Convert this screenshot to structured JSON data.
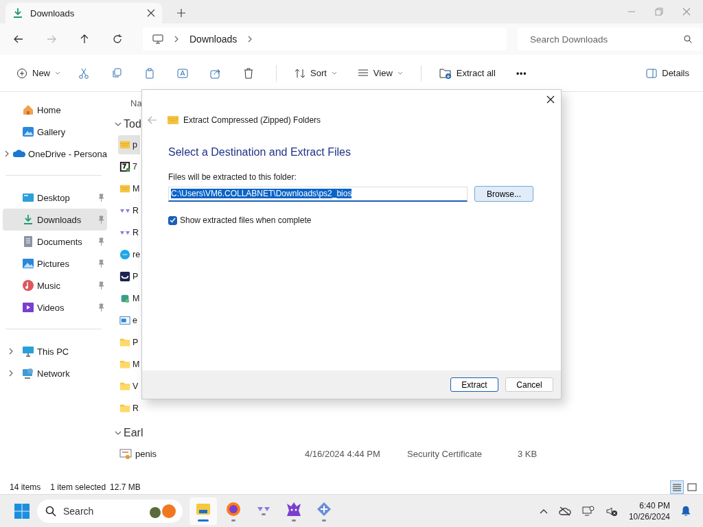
{
  "tab": {
    "title": "Downloads"
  },
  "address": {
    "breadcrumb": [
      "Downloads"
    ],
    "search_placeholder": "Search Downloads"
  },
  "command_bar": [
    {
      "kind": "menu",
      "label": "New"
    },
    {
      "kind": "icon"
    },
    {
      "kind": "icon"
    },
    {
      "kind": "icon"
    },
    {
      "kind": "icon"
    },
    {
      "kind": "icon"
    },
    {
      "kind": "icon"
    },
    {
      "kind": "menu",
      "label": "Sort"
    },
    {
      "kind": "menu",
      "label": "View"
    },
    {
      "kind": "button",
      "label": "Extract all"
    },
    {
      "kind": "more",
      "label": "•••"
    },
    {
      "kind": "details",
      "label": "Details"
    }
  ],
  "nav": [
    [
      {
        "label": "Home",
        "selected": false,
        "expandable": false,
        "pinned": false
      },
      {
        "label": "Gallery",
        "selected": false,
        "expandable": false,
        "pinned": false
      },
      {
        "label": "OneDrive - Persona",
        "selected": false,
        "expandable": true,
        "pinned": false
      }
    ],
    [
      {
        "label": "Desktop",
        "selected": false,
        "expandable": false,
        "pinned": true
      },
      {
        "label": "Downloads",
        "selected": true,
        "expandable": false,
        "pinned": true
      },
      {
        "label": "Documents",
        "selected": false,
        "expandable": false,
        "pinned": true
      },
      {
        "label": "Pictures",
        "selected": false,
        "expandable": false,
        "pinned": true
      },
      {
        "label": "Music",
        "selected": false,
        "expandable": false,
        "pinned": true
      },
      {
        "label": "Videos",
        "selected": false,
        "expandable": false,
        "pinned": true
      }
    ],
    [
      {
        "label": "This PC",
        "selected": false,
        "expandable": true,
        "pinned": false
      },
      {
        "label": "Network",
        "selected": false,
        "expandable": true,
        "pinned": false
      }
    ]
  ],
  "files": {
    "column_1": "Na",
    "groups": [
      {
        "label": "Tod",
        "expanded": true,
        "rows": [
          {
            "name": "p",
            "selected": true
          },
          {
            "name": "7",
            "selected": false
          },
          {
            "name": "M",
            "selected": false
          },
          {
            "name": "R",
            "selected": false
          },
          {
            "name": "R",
            "selected": false
          },
          {
            "name": "re",
            "selected": false
          },
          {
            "name": "P",
            "selected": false
          },
          {
            "name": "M",
            "selected": false
          },
          {
            "name": "e",
            "selected": false
          },
          {
            "name": "P",
            "selected": false
          },
          {
            "name": "M",
            "selected": false
          },
          {
            "name": "V",
            "selected": false
          },
          {
            "name": "R",
            "selected": false
          }
        ]
      },
      {
        "label": "Earl",
        "expanded": true,
        "rows": [
          {
            "name": "penis",
            "date": "4/16/2024 4:44 PM",
            "type": "Security Certificate",
            "size": "3 KB",
            "selected": false
          }
        ]
      }
    ]
  },
  "dialog": {
    "title": "Extract Compressed (Zipped) Folders",
    "heading": "Select a Destination and Extract Files",
    "field_label": "Files will be extracted to this folder:",
    "path": "C:\\Users\\VM6.COLLABNET\\Downloads\\ps2_bios",
    "browse": "Browse...",
    "checkbox": {
      "label": "Show extracted files when complete",
      "checked": true
    },
    "buttons": [
      {
        "label": "Extract",
        "default": true
      },
      {
        "label": "Cancel",
        "default": false
      }
    ]
  },
  "status_bar": {
    "count": "14 items",
    "selection": "1 item selected",
    "size": "12.7 MB",
    "views": [
      {
        "selected": true
      },
      {
        "selected": false
      }
    ]
  },
  "taskbar": {
    "search_placeholder": "Search",
    "apps": [
      {
        "active": true
      },
      {
        "active": false
      },
      {
        "active": false
      },
      {
        "active": false
      },
      {
        "active": false
      }
    ],
    "time": "6:40 PM",
    "date": "10/26/2024"
  }
}
